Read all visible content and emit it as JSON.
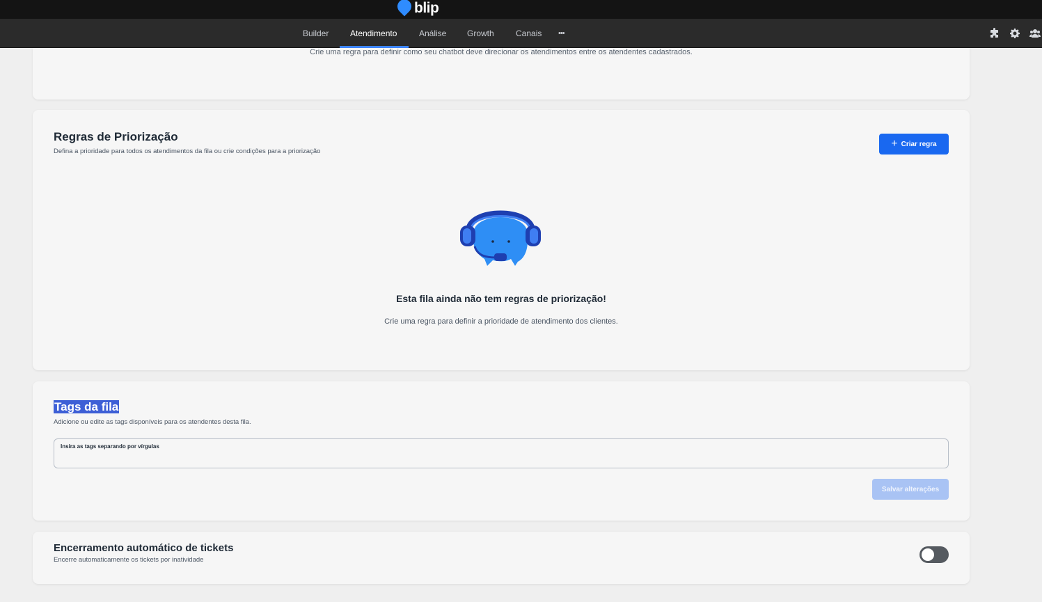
{
  "brand": {
    "name": "blip",
    "color": "#2f8cff"
  },
  "nav": {
    "items": [
      {
        "label": "Builder",
        "active": false
      },
      {
        "label": "Atendimento",
        "active": true
      },
      {
        "label": "Análise",
        "active": false
      },
      {
        "label": "Growth",
        "active": false
      },
      {
        "label": "Canais",
        "active": false
      }
    ],
    "more_label": "•••",
    "right_icons": [
      "puzzle-icon",
      "gear-icon",
      "team-icon"
    ],
    "accent": "#3f86ff"
  },
  "attendance_rules": {
    "description": "Crie uma regra para definir como seu chatbot deve direcionar os atendimentos entre os atendentes cadastrados."
  },
  "priority_rules": {
    "title": "Regras de Priorização",
    "subtitle": "Defina a prioridade para todos os atendimentos da fila ou crie condições para a priorização",
    "create_button": "Criar regra",
    "empty_title": "Esta fila ainda não tem regras de priorização!",
    "empty_subtitle": "Crie uma regra para definir a prioridade de atendimento dos clientes."
  },
  "queue_tags": {
    "title": "Tags da fila",
    "subtitle": "Adicione ou edite as tags disponíveis para os atendentes desta fila.",
    "input_label": "Insira as tags separando por vírgulas",
    "input_value": "",
    "save_button": "Salvar alterações"
  },
  "auto_close": {
    "title": "Encerramento automático de tickets",
    "subtitle": "Encerre automaticamente os tickets por inatividade",
    "enabled": false
  },
  "colors": {
    "primary": "#1968f0",
    "primary_disabled": "#a9c3f4",
    "highlight": "#3d5fd6"
  }
}
